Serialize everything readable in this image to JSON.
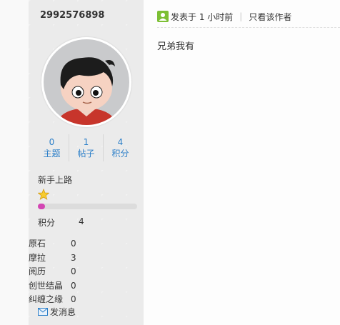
{
  "author": {
    "username": "2992576898"
  },
  "stats": [
    {
      "num": "0",
      "label": "主题"
    },
    {
      "num": "1",
      "label": "帖子"
    },
    {
      "num": "4",
      "label": "积分"
    }
  ],
  "rank": {
    "title": "新手上路",
    "progress": 0.07
  },
  "credit": {
    "label": "积分",
    "value": "4"
  },
  "ext": [
    {
      "label": "原石",
      "value": "0"
    },
    {
      "label": "摩拉",
      "value": "3"
    },
    {
      "label": "阅历",
      "value": "0"
    },
    {
      "label": "创世结晶",
      "value": "0"
    },
    {
      "label": "纠缠之缘",
      "value": "0"
    }
  ],
  "send_message": "发消息",
  "post": {
    "posted": "发表于 1 小时前",
    "only_author": "只看该作者",
    "content": "兄弟我有"
  },
  "colors": {
    "link": "#2a7ec8",
    "progress": "#d346b3",
    "poster_icon": "#7cbf34"
  }
}
